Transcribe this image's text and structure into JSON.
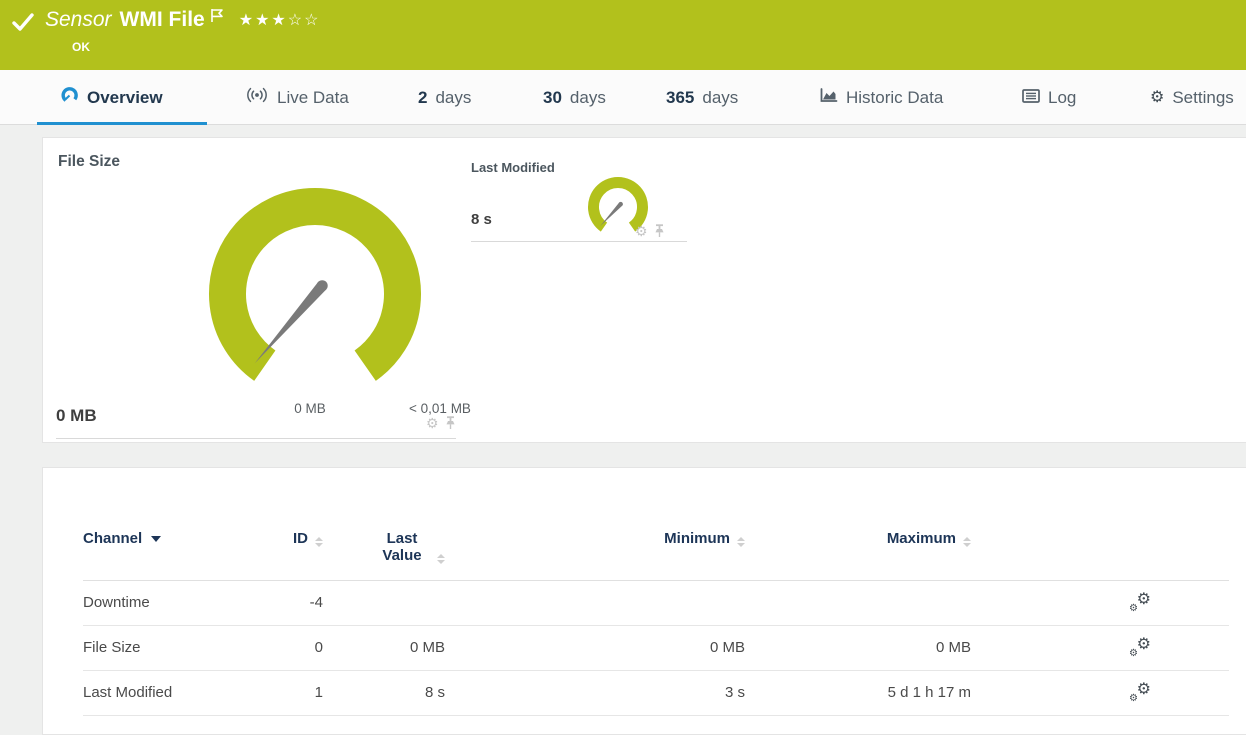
{
  "header": {
    "type_label": "Sensor",
    "title": "WMI File",
    "status": "OK",
    "priority": {
      "stars_filled": 3,
      "stars_total": 5,
      "glyph": "★★★☆☆"
    },
    "color": "#b2c11c"
  },
  "tabs": {
    "overview": {
      "label": "Overview",
      "active": true
    },
    "live_data": {
      "label": "Live Data"
    },
    "days_2": {
      "value": "2",
      "label": "days"
    },
    "days_30": {
      "value": "30",
      "label": "days"
    },
    "days_365": {
      "value": "365",
      "label": "days"
    },
    "historic": {
      "label": "Historic Data"
    },
    "log": {
      "label": "Log"
    },
    "settings": {
      "label": "Settings"
    }
  },
  "gauges": {
    "file_size": {
      "title": "File Size",
      "current_value": "0 MB",
      "scale_min": "0 MB",
      "scale_max": "< 0,01 MB",
      "arc_color": "#b2c11c"
    },
    "last_modified": {
      "title": "Last Modified",
      "current_value": "8 s",
      "arc_color": "#b2c11c"
    }
  },
  "channels_table": {
    "headers": {
      "channel": "Channel",
      "id": "ID",
      "last_value": "Last Value",
      "minimum": "Minimum",
      "maximum": "Maximum"
    },
    "rows": [
      {
        "channel": "Downtime",
        "id": "-4",
        "last_value": "",
        "minimum": "",
        "maximum": ""
      },
      {
        "channel": "File Size",
        "id": "0",
        "last_value": "0 MB",
        "minimum": "0 MB",
        "maximum": "0 MB"
      },
      {
        "channel": "Last Modified",
        "id": "1",
        "last_value": "8 s",
        "minimum": "3 s",
        "maximum": "5 d 1 h 17 m"
      }
    ]
  },
  "colors": {
    "brand_green": "#b2c11c",
    "active_tab_blue": "#2090d0",
    "table_header_navy": "#1d3557",
    "needle_gray": "#7a7a7a"
  }
}
